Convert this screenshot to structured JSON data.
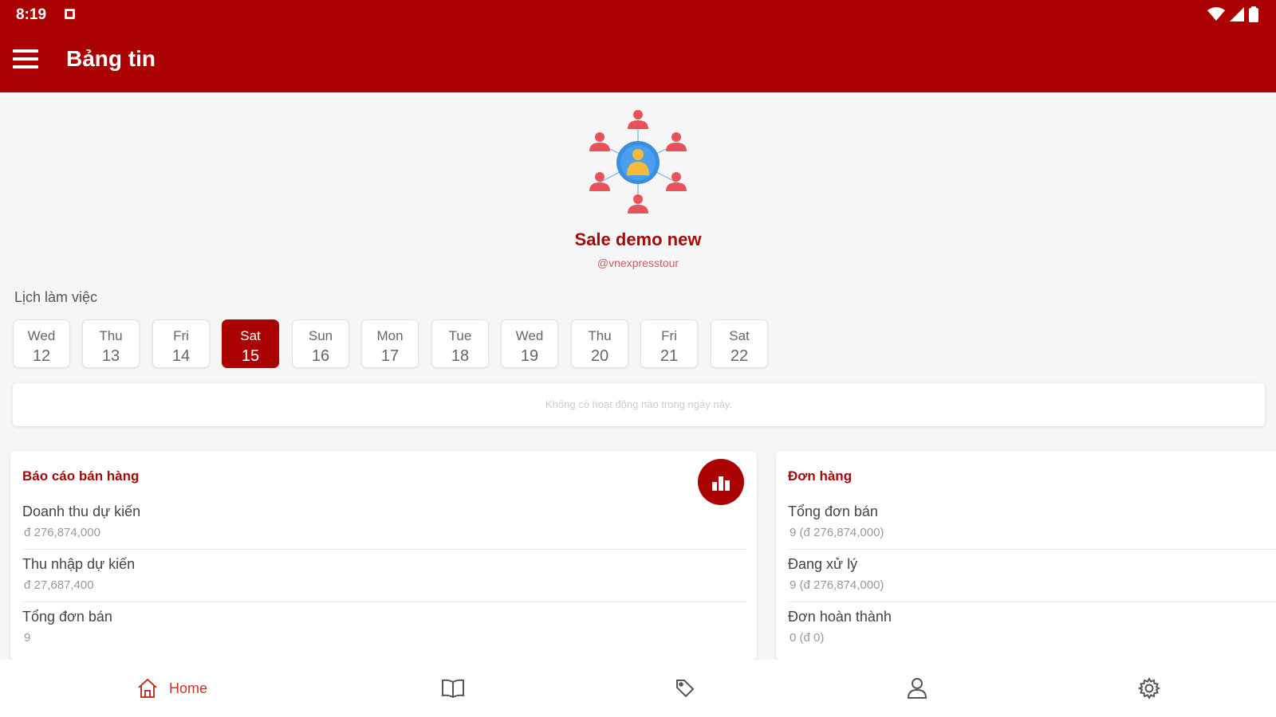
{
  "status_bar": {
    "time": "8:19"
  },
  "app_bar": {
    "title": "Bảng tin"
  },
  "profile": {
    "name": "Sale demo new",
    "handle": "@vnexpresstour"
  },
  "schedule": {
    "label": "Lịch làm việc",
    "days": [
      {
        "name": "Wed",
        "date": "12",
        "selected": false
      },
      {
        "name": "Thu",
        "date": "13",
        "selected": false
      },
      {
        "name": "Fri",
        "date": "14",
        "selected": false
      },
      {
        "name": "Sat",
        "date": "15",
        "selected": true
      },
      {
        "name": "Sun",
        "date": "16",
        "selected": false
      },
      {
        "name": "Mon",
        "date": "17",
        "selected": false
      },
      {
        "name": "Tue",
        "date": "18",
        "selected": false
      },
      {
        "name": "Wed",
        "date": "19",
        "selected": false
      },
      {
        "name": "Thu",
        "date": "20",
        "selected": false
      },
      {
        "name": "Fri",
        "date": "21",
        "selected": false
      },
      {
        "name": "Sat",
        "date": "22",
        "selected": false
      }
    ],
    "empty_text": "Không có hoạt động nào trong ngày này."
  },
  "sales_report": {
    "title": "Báo cáo bán hàng",
    "rows": [
      {
        "label": "Doanh thu dự kiến",
        "value": "đ 276,874,000"
      },
      {
        "label": "Thu nhập dự kiến",
        "value": "đ 27,687,400"
      },
      {
        "label": "Tổng đơn bán",
        "value": "9"
      }
    ]
  },
  "orders": {
    "title": "Đơn hàng",
    "rows": [
      {
        "label": "Tổng đơn bán",
        "value": "9 (đ 276,874,000)"
      },
      {
        "label": "Đang xử lý",
        "value": "9 (đ 276,874,000)"
      },
      {
        "label": "Đơn hoàn thành",
        "value": "0 (đ 0)"
      }
    ]
  },
  "bottom_nav": {
    "home_label": "Home",
    "items": [
      "home-icon",
      "book-icon",
      "tag-icon",
      "user-icon",
      "gear-icon"
    ]
  },
  "colors": {
    "primary": "#ab0303",
    "accent_text": "#a50a0a",
    "person_red": "#e8525a",
    "center_blue": "#3b8fe0",
    "center_gold": "#f6b93b"
  }
}
